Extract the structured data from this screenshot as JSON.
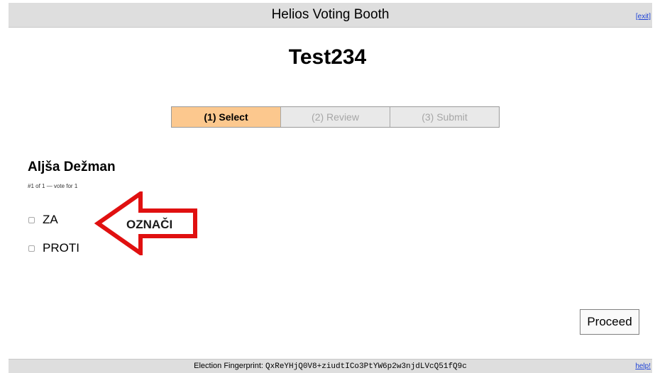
{
  "header": {
    "title": "Helios Voting Booth",
    "exit_label": "[exit]"
  },
  "election": {
    "title": "Test234"
  },
  "steps": [
    {
      "label": "(1) Select",
      "active": true
    },
    {
      "label": "(2) Review",
      "active": false
    },
    {
      "label": "(3) Submit",
      "active": false
    }
  ],
  "question": {
    "title": "Aljša Dežman",
    "subtitle": "#1 of 1 — vote for 1",
    "answers": [
      {
        "label": "ZA",
        "checked": false
      },
      {
        "label": "PROTI",
        "checked": false
      }
    ]
  },
  "annotation": {
    "text": "OZNAČI",
    "icon": "red-arrow-left-icon",
    "color": "#e01010"
  },
  "proceed_label": "Proceed",
  "footer": {
    "fingerprint_label": "Election Fingerprint:",
    "fingerprint_value": "QxReYHjQ0V8+ziudtICo3PtYW6p2w3njdLVcQ51fQ9c",
    "help_label": "help!"
  },
  "colors": {
    "active_step": "#fcc88e",
    "inactive_step": "#e9e9e9",
    "bar": "#dedede",
    "link": "#1a3fd6"
  }
}
